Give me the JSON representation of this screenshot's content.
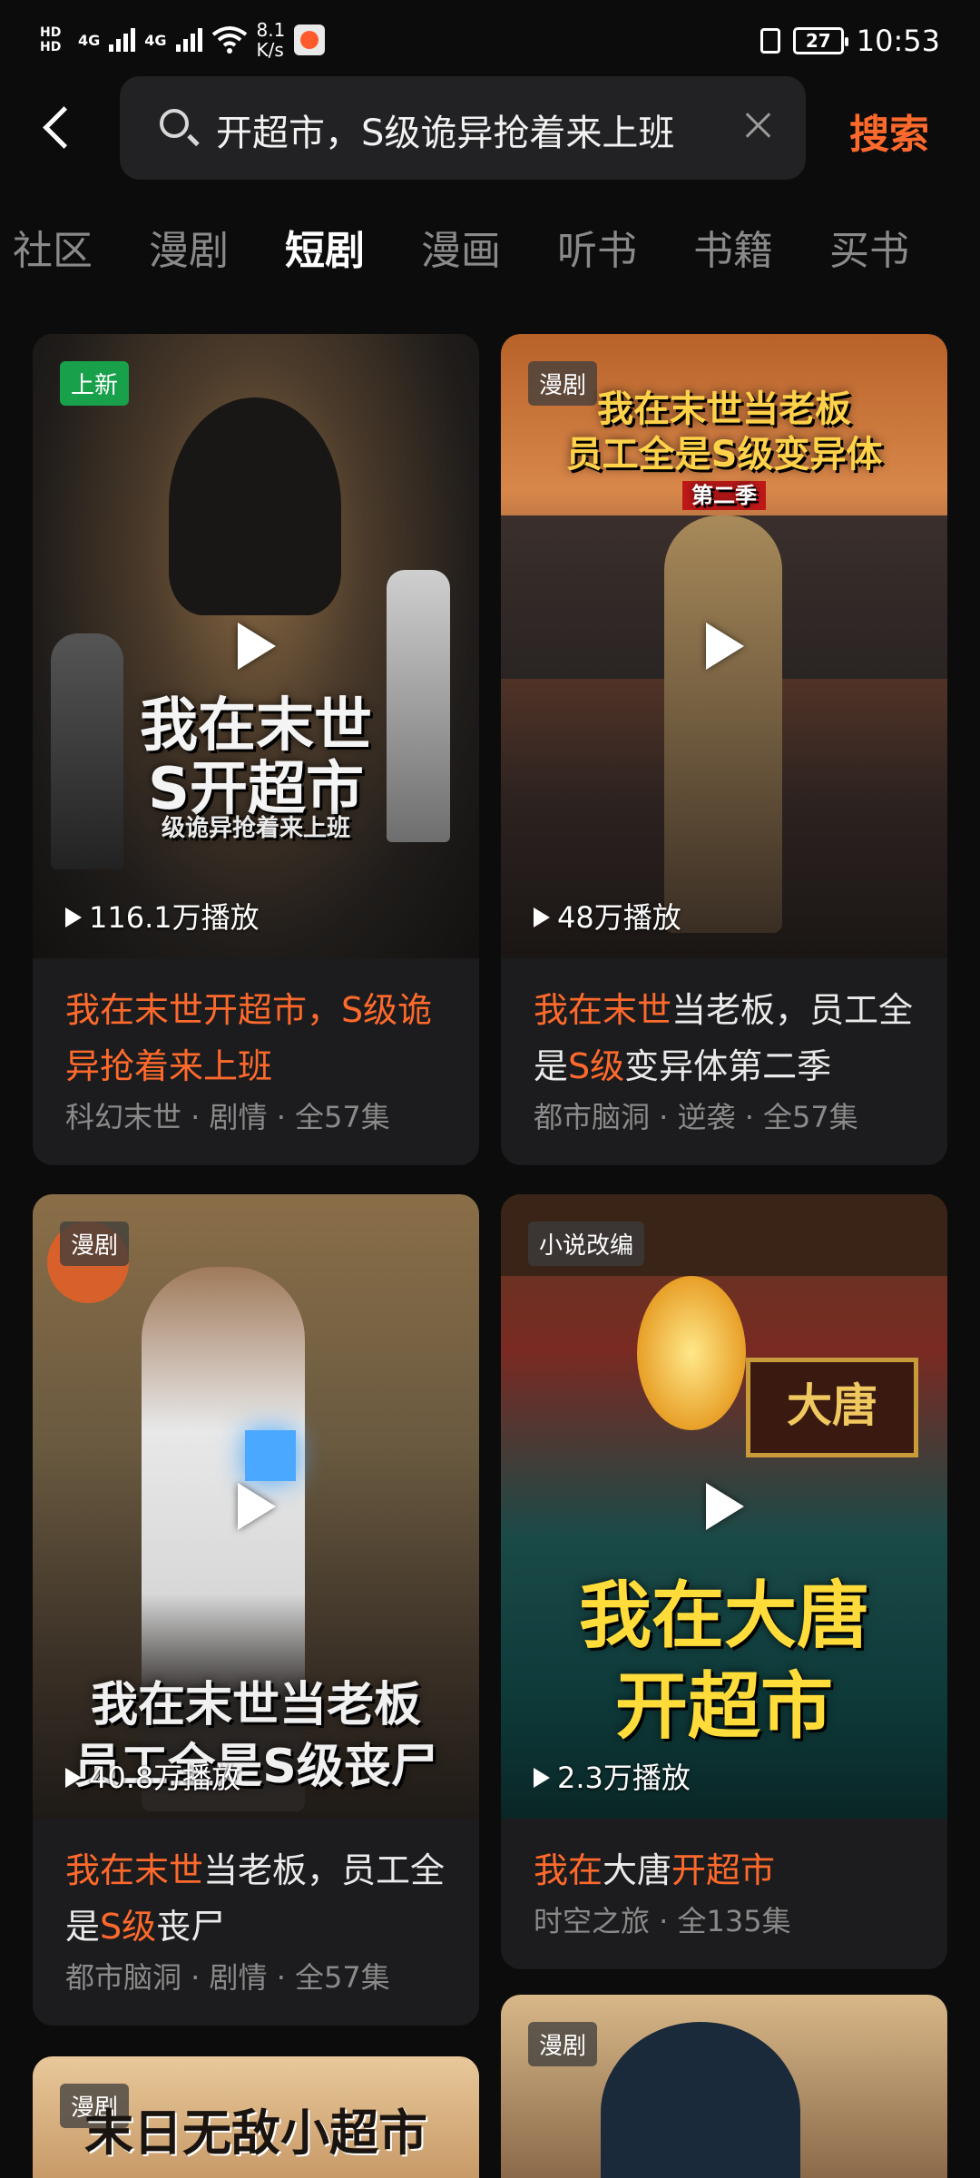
{
  "status_bar": {
    "hd1": "HD",
    "hd2": "HD",
    "net1": "4G",
    "net2": "4G",
    "speed_value": "8.1",
    "speed_unit": "K/s",
    "battery": "27",
    "time": "10:53"
  },
  "search": {
    "query": "开超市，S级诡异抢着来上班",
    "button_label": "搜索"
  },
  "tabs": [
    "社区",
    "漫剧",
    "短剧",
    "漫画",
    "听书",
    "书籍",
    "买书"
  ],
  "active_tab": "短剧",
  "cards": [
    {
      "badge": "上新",
      "views": "116.1万播放",
      "cover_title_line1": "我在末世",
      "cover_title_line2": "S开超市",
      "cover_title_line3": "级诡异抢着来上班",
      "title_part1": "我在末世开超市，S级诡异抢着来上班",
      "title_part2": "",
      "title_part3": "",
      "title_part4": "",
      "meta": "科幻末世 · 剧情 · 全57集"
    },
    {
      "badge": "漫剧",
      "views": "48万播放",
      "cover_title_line1": "我在末世当老板",
      "cover_title_line2": "员工全是S级变异体",
      "cover_title_line3": "第二季",
      "title_part1": "我在末世",
      "title_part2": "当老板，员工全是",
      "title_part3": "S级",
      "title_part4": "变异体第二季",
      "meta": "都市脑洞 · 逆袭 · 全57集"
    },
    {
      "badge": "漫剧",
      "views": "40.8万播放",
      "cover_title_line1": "我在末世当老板",
      "cover_title_line2": "员工全是S级丧尸",
      "title_part1": "我在末世",
      "title_part2": "当老板，员工全是",
      "title_part3": "S级",
      "title_part4": "丧尸",
      "meta": "都市脑洞 · 剧情 · 全57集"
    },
    {
      "badge": "小说改编",
      "views": "2.3万播放",
      "cover_title_line1": "我在大唐",
      "cover_title_line2": "开超市",
      "sign": "大唐",
      "title_part1": "我在",
      "title_part2": "大唐",
      "title_part3": "开超市",
      "title_part4": "",
      "meta": "时空之旅 · 全135集"
    },
    {
      "badge": "漫剧",
      "cover_title_line1": "末日无敌小超市"
    },
    {
      "badge": "漫剧"
    }
  ]
}
